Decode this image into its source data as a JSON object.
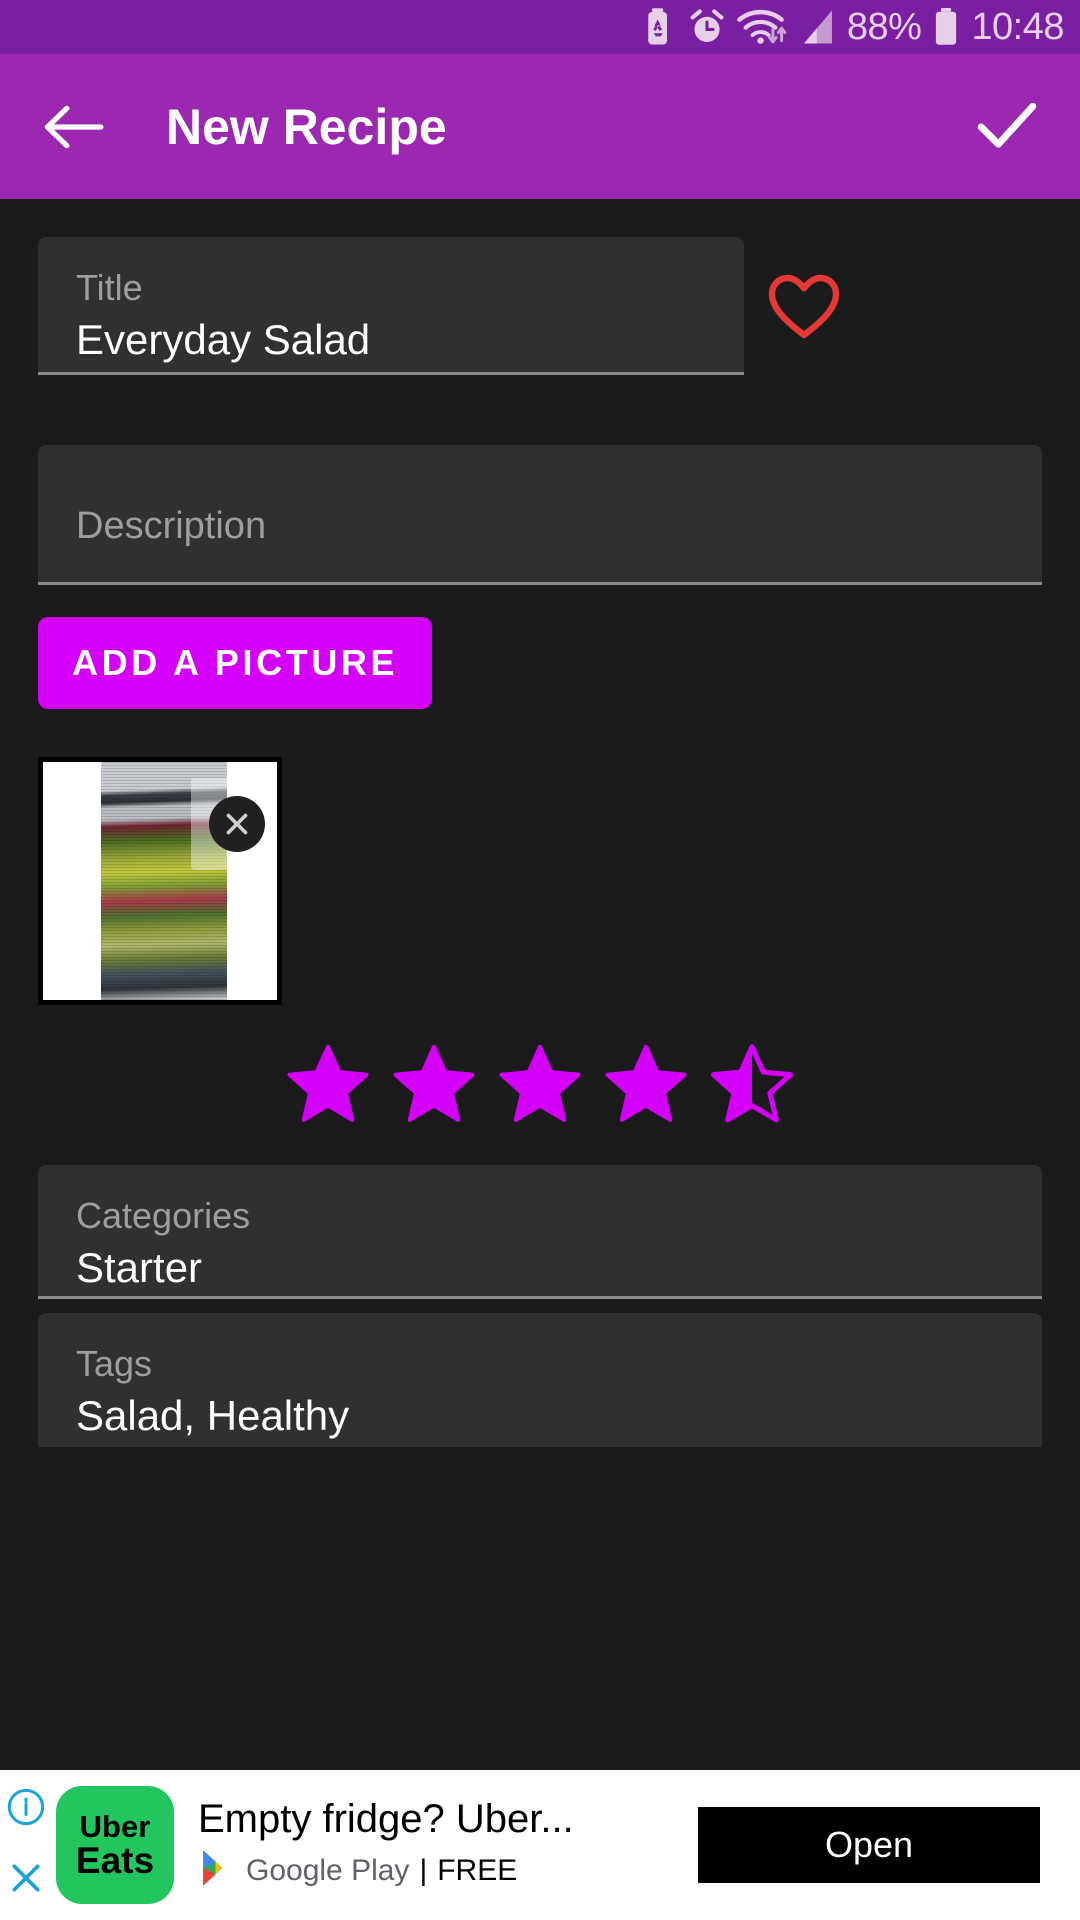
{
  "status_bar": {
    "battery_percent": "88%",
    "time": "10:48",
    "icons": [
      "battery-saver-icon",
      "alarm-icon",
      "wifi-icon",
      "cellular-signal-icon",
      "battery-icon"
    ]
  },
  "app_bar": {
    "back_label": "back-arrow",
    "title": "New Recipe",
    "confirm_label": "checkmark"
  },
  "form": {
    "title": {
      "label": "Title",
      "value": "Everyday Salad"
    },
    "favorite": {
      "name": "favorite-heart",
      "filled": false,
      "color": "#e53935"
    },
    "description": {
      "label": "Description",
      "value": "",
      "placeholder": "Description"
    },
    "add_picture_button": "ADD A PICTURE",
    "picture": {
      "remove_label": "remove-picture",
      "alt": "salad-photo-thumbnail"
    },
    "rating": {
      "value": 4.5,
      "max": 5,
      "color": "#d500f9"
    },
    "categories": {
      "label": "Categories",
      "value": "Starter"
    },
    "tags": {
      "label": "Tags",
      "value": "Salad, Healthy"
    }
  },
  "ad": {
    "brand_line1": "Uber",
    "brand_line2": "Eats",
    "headline": "Empty fridge? Uber...",
    "store": "Google Play",
    "separator": "|",
    "price": "FREE",
    "cta": "Open"
  }
}
